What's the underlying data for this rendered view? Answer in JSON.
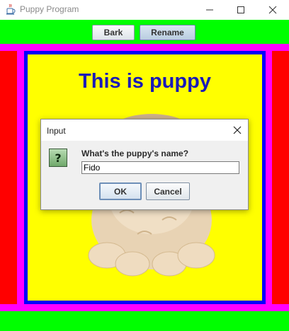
{
  "window": {
    "title": "Puppy Program",
    "icon": "java-cup-icon",
    "controls": [
      "minimize-icon",
      "maximize-icon",
      "close-icon"
    ]
  },
  "toolbar": {
    "bark_label": "Bark",
    "rename_label": "Rename"
  },
  "panel": {
    "headline": "This is puppy"
  },
  "dialog": {
    "title": "Input",
    "icon": "question-icon",
    "icon_glyph": "?",
    "prompt": "What's the puppy's name?",
    "input_value": "Fido",
    "ok_label": "OK",
    "cancel_label": "Cancel"
  },
  "colors": {
    "toolbar_green": "#00ff00",
    "border_magenta": "#ff00ff",
    "side_red": "#ff0000",
    "panel_blue": "#0000ff",
    "panel_yellow": "#ffff00",
    "headline_blue": "#1a1ab8"
  }
}
